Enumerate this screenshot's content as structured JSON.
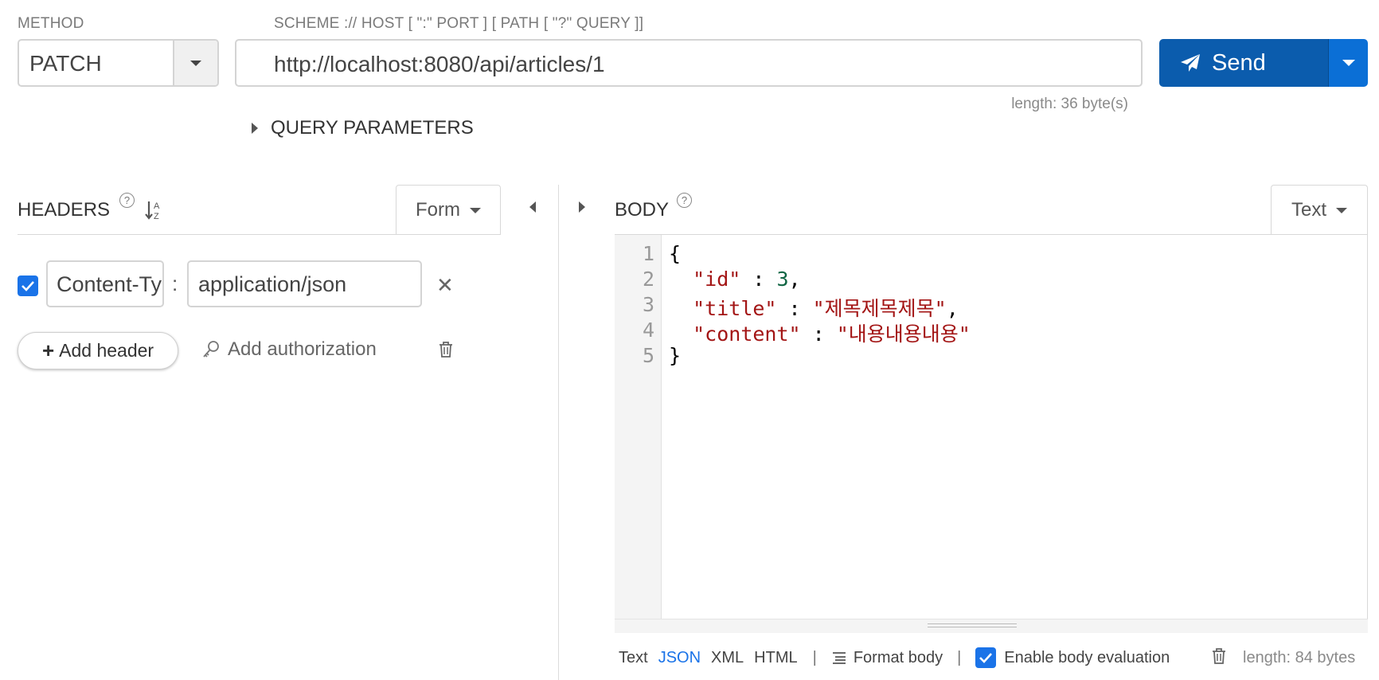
{
  "method": {
    "label": "METHOD",
    "value": "PATCH",
    "caret_icon": "chevron-down-icon"
  },
  "url": {
    "label": "SCHEME :// HOST [ \":\" PORT ] [ PATH [ \"?\" QUERY ]]",
    "value": "http://localhost:8080/api/articles/1",
    "length_text": "length: 36 byte(s)"
  },
  "send": {
    "label": "Send",
    "icon": "paper-plane-icon",
    "color": "#0b5cad",
    "dropdown_color": "#0b6fd6"
  },
  "query_parameters": {
    "label": "QUERY PARAMETERS"
  },
  "headers": {
    "title": "HEADERS",
    "help": "?",
    "mode": "Form",
    "rows": [
      {
        "enabled": true,
        "name": "Content-Type",
        "value": "application/json"
      }
    ],
    "add_header_label": "Add header",
    "add_authorization_label": "Add authorization"
  },
  "body": {
    "title": "BODY",
    "help": "?",
    "mode": "Text",
    "line_numbers": [
      "1",
      "2",
      "3",
      "4",
      "5"
    ],
    "lines": [
      {
        "open": "{"
      },
      {
        "key": "\"id\"",
        "sep": " : ",
        "num": "3",
        "tail": ","
      },
      {
        "key": "\"title\"",
        "sep": " : ",
        "str": "\"제목제목제목\"",
        "tail": ","
      },
      {
        "key": "\"content\"",
        "sep": " : ",
        "str": "\"내용내용내용\""
      },
      {
        "close": "}"
      }
    ],
    "formats": [
      "Text",
      "JSON",
      "XML",
      "HTML"
    ],
    "active_format": "JSON",
    "separator": "|",
    "format_body_label": "Format body",
    "enable_evaluation_label": "Enable body evaluation",
    "enable_evaluation": true,
    "length_text": "length: 84 bytes"
  },
  "colors": {
    "accent": "#1a73e8",
    "json_key": "#a31515",
    "json_number": "#116644"
  }
}
